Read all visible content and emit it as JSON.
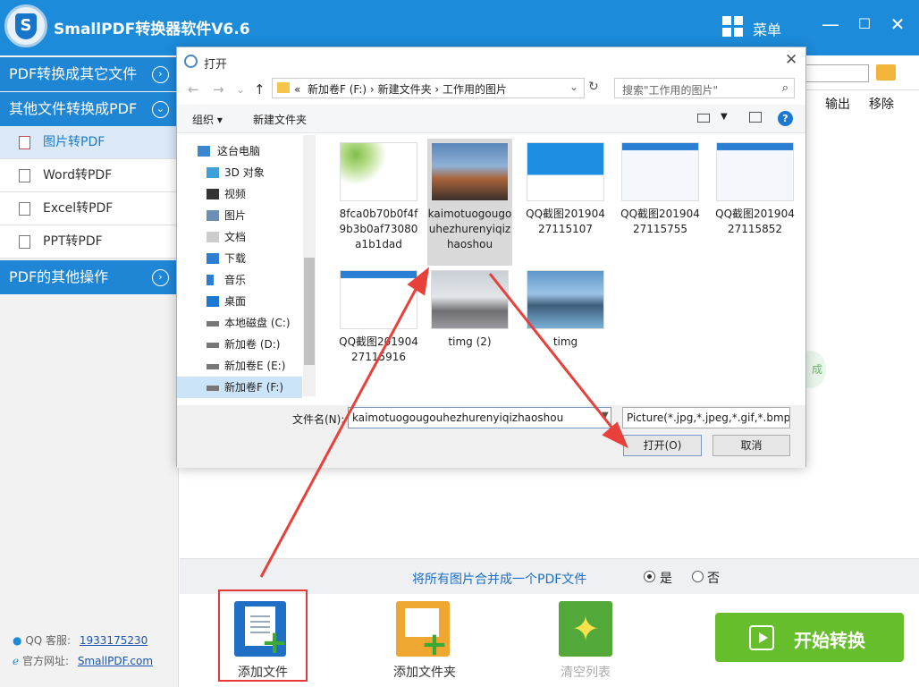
{
  "app": {
    "title": "SmallPDF转换器软件V6.6",
    "menu_label": "菜单",
    "logo_letter": "S"
  },
  "window_controls": {
    "minimize": "—",
    "maximize": "☐",
    "close": "✕"
  },
  "sidebar": {
    "section1": {
      "label": "PDF转换成其它文件",
      "icon": "chevron-right-icon"
    },
    "section2": {
      "label": "其他文件转换成PDF",
      "icon": "chevron-down-icon"
    },
    "items": [
      {
        "label": "图片转PDF",
        "active": true
      },
      {
        "label": "Word转PDF",
        "active": false
      },
      {
        "label": "Excel转PDF",
        "active": false
      },
      {
        "label": "PPT转PDF",
        "active": false
      }
    ],
    "section3": {
      "label": "PDF的其他操作",
      "icon": "chevron-right-icon"
    },
    "qq": {
      "label": "QQ 客服:",
      "value": "1933175230"
    },
    "site": {
      "label": "官方网址:",
      "value": "SmallPDF.com"
    }
  },
  "main": {
    "columns": {
      "output": "输出",
      "remove": "移除"
    },
    "side_fragment": "成",
    "merge": {
      "text": "将所有图片合并成一个PDF文件",
      "yes": "是",
      "no": "否",
      "selected": "是"
    },
    "toolbar": {
      "add_file": "添加文件",
      "add_folder": "添加文件夹",
      "clear_list": "清空列表",
      "start": "开始转换"
    },
    "colors": {
      "accent": "#1f86d6",
      "start": "#67be2c",
      "highlight": "#e53935"
    }
  },
  "dialog": {
    "title": "打开",
    "nav": {
      "back": "←",
      "forward": "→",
      "down": "⌄",
      "up": "↑",
      "refresh": "↻",
      "overflow": "«"
    },
    "address": {
      "crumbs": [
        "新加卷F (F:)",
        "新建文件夹",
        "工作用的图片"
      ],
      "sep": "›"
    },
    "search_placeholder": "搜索\"工作用的图片\"",
    "organize": "组织 ▾",
    "new_folder": "新建文件夹",
    "tree": [
      {
        "label": "这台电脑",
        "top": true
      },
      {
        "label": "3D 对象"
      },
      {
        "label": "视频"
      },
      {
        "label": "图片"
      },
      {
        "label": "文档"
      },
      {
        "label": "下载"
      },
      {
        "label": "音乐"
      },
      {
        "label": "桌面"
      },
      {
        "label": "本地磁盘 (C:)"
      },
      {
        "label": "新加卷 (D:)"
      },
      {
        "label": "新加卷E (E:)"
      },
      {
        "label": "新加卷F (F:)",
        "selected": true
      }
    ],
    "files": [
      {
        "name": "8fca0b70b0f4f9b3b0af73080a1b1dad",
        "thumb": "leaves"
      },
      {
        "name": "kaimotuogougouhezhurenyiqizhaoshou",
        "thumb": "dog",
        "selected": true
      },
      {
        "name": "QQ截图20190427115107",
        "thumb": "blue"
      },
      {
        "name": "QQ截图20190427115755",
        "thumb": "flow"
      },
      {
        "name": "QQ截图20190427115852",
        "thumb": "flow"
      },
      {
        "name": "QQ截图20190427115916",
        "thumb": "list"
      },
      {
        "name": "timg (2)",
        "thumb": "snow"
      },
      {
        "name": "timg",
        "thumb": "lake"
      }
    ],
    "filename_label": "文件名(N):",
    "filename_value": "kaimotuogougouhezhurenyiqizhaoshou",
    "filter": "Picture(*.jpg,*.jpeg,*.gif,*.bmp)",
    "open_button": "打开(O)",
    "cancel_button": "取消"
  }
}
